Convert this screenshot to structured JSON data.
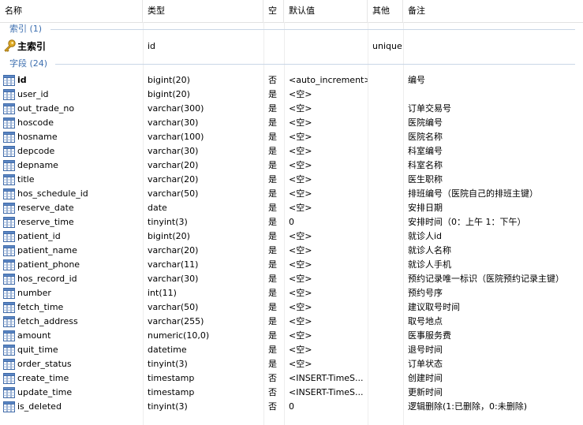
{
  "columns": {
    "name": "名称",
    "type": "类型",
    "null": "空",
    "default": "默认值",
    "other": "其他",
    "note": "备注"
  },
  "groups": {
    "index": "索引 (1)",
    "fields": "字段 (24)"
  },
  "index_row": {
    "name": "主索引",
    "type": "id",
    "null": "",
    "default": "",
    "other": "unique",
    "note": ""
  },
  "rows": [
    {
      "name": "id",
      "type": "bigint(20)",
      "null": "否",
      "default": "<auto_increment>",
      "other": "",
      "note": "编号"
    },
    {
      "name": "user_id",
      "type": "bigint(20)",
      "null": "是",
      "default": "<空>",
      "other": "",
      "note": ""
    },
    {
      "name": "out_trade_no",
      "type": "varchar(300)",
      "null": "是",
      "default": "<空>",
      "other": "",
      "note": "订单交易号"
    },
    {
      "name": "hoscode",
      "type": "varchar(30)",
      "null": "是",
      "default": "<空>",
      "other": "",
      "note": "医院编号"
    },
    {
      "name": "hosname",
      "type": "varchar(100)",
      "null": "是",
      "default": "<空>",
      "other": "",
      "note": "医院名称"
    },
    {
      "name": "depcode",
      "type": "varchar(30)",
      "null": "是",
      "default": "<空>",
      "other": "",
      "note": "科室编号"
    },
    {
      "name": "depname",
      "type": "varchar(20)",
      "null": "是",
      "default": "<空>",
      "other": "",
      "note": "科室名称"
    },
    {
      "name": "title",
      "type": "varchar(20)",
      "null": "是",
      "default": "<空>",
      "other": "",
      "note": "医生职称"
    },
    {
      "name": "hos_schedule_id",
      "type": "varchar(50)",
      "null": "是",
      "default": "<空>",
      "other": "",
      "note": "排班编号（医院自己的排班主键）"
    },
    {
      "name": "reserve_date",
      "type": "date",
      "null": "是",
      "default": "<空>",
      "other": "",
      "note": "安排日期"
    },
    {
      "name": "reserve_time",
      "type": "tinyint(3)",
      "null": "是",
      "default": "0",
      "other": "",
      "note": "安排时间（0：上午 1：下午）"
    },
    {
      "name": "patient_id",
      "type": "bigint(20)",
      "null": "是",
      "default": "<空>",
      "other": "",
      "note": "就诊人id"
    },
    {
      "name": "patient_name",
      "type": "varchar(20)",
      "null": "是",
      "default": "<空>",
      "other": "",
      "note": "就诊人名称"
    },
    {
      "name": "patient_phone",
      "type": "varchar(11)",
      "null": "是",
      "default": "<空>",
      "other": "",
      "note": "就诊人手机"
    },
    {
      "name": "hos_record_id",
      "type": "varchar(30)",
      "null": "是",
      "default": "<空>",
      "other": "",
      "note": "预约记录唯一标识（医院预约记录主键）"
    },
    {
      "name": "number",
      "type": "int(11)",
      "null": "是",
      "default": "<空>",
      "other": "",
      "note": "预约号序"
    },
    {
      "name": "fetch_time",
      "type": "varchar(50)",
      "null": "是",
      "default": "<空>",
      "other": "",
      "note": "建议取号时间"
    },
    {
      "name": "fetch_address",
      "type": "varchar(255)",
      "null": "是",
      "default": "<空>",
      "other": "",
      "note": "取号地点"
    },
    {
      "name": "amount",
      "type": "numeric(10,0)",
      "null": "是",
      "default": "<空>",
      "other": "",
      "note": "医事服务费"
    },
    {
      "name": "quit_time",
      "type": "datetime",
      "null": "是",
      "default": "<空>",
      "other": "",
      "note": "退号时间"
    },
    {
      "name": "order_status",
      "type": "tinyint(3)",
      "null": "是",
      "default": "<空>",
      "other": "",
      "note": "订单状态"
    },
    {
      "name": "create_time",
      "type": "timestamp",
      "null": "否",
      "default": "<INSERT-TimeS...",
      "other": "",
      "note": "创建时间"
    },
    {
      "name": "update_time",
      "type": "timestamp",
      "null": "否",
      "default": "<INSERT-TimeS...",
      "other": "",
      "note": "更新时间"
    },
    {
      "name": "is_deleted",
      "type": "tinyint(3)",
      "null": "否",
      "default": "0",
      "other": "",
      "note": "逻辑删除(1:已删除，0:未删除)"
    }
  ],
  "icons": {
    "key": "key-icon",
    "field": "table-field-icon"
  },
  "colors": {
    "group_text": "#3d6fb0",
    "key_gold": "#d8a21c"
  }
}
